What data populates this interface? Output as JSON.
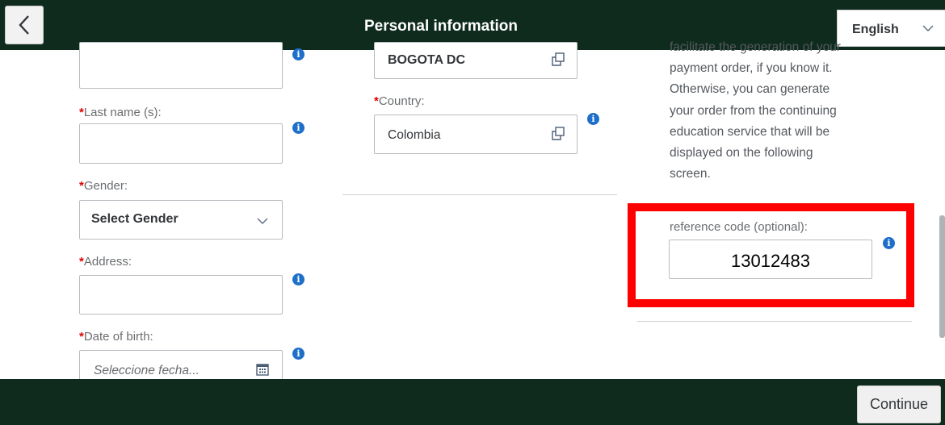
{
  "header": {
    "title": "Personal information",
    "back_icon": "chevron-left-icon",
    "language": {
      "selected": "English"
    }
  },
  "left_column": {
    "last_name": {
      "required_mark": "*",
      "label": "Last name (s):",
      "value": ""
    },
    "gender": {
      "required_mark": "*",
      "label": "Gender:",
      "selected": "Select Gender"
    },
    "address": {
      "required_mark": "*",
      "label": "Address:",
      "value": ""
    },
    "date_of_birth": {
      "required_mark": "*",
      "label": "Date of birth:",
      "placeholder": "Seleccione fecha..."
    }
  },
  "middle_column": {
    "city": {
      "value": "BOGOTA DC"
    },
    "country": {
      "required_mark": "*",
      "label": "Country:",
      "value": "Colombia"
    }
  },
  "right_column": {
    "help_lines": [
      "facilitate the generation of your",
      "payment order, if you know it.",
      "Otherwise, you can generate",
      "your order from the continuing",
      "education service that will be",
      "displayed on the following",
      "screen."
    ],
    "reference_code": {
      "label": "reference code (optional):",
      "value": "13012483"
    }
  },
  "footer": {
    "continue_label": "Continue"
  },
  "colors": {
    "bar_background": "#0e2b1e",
    "required": "#e00000",
    "info_icon": "#1d6fc9",
    "highlight": "#ff0000"
  },
  "info_glyph": "i"
}
